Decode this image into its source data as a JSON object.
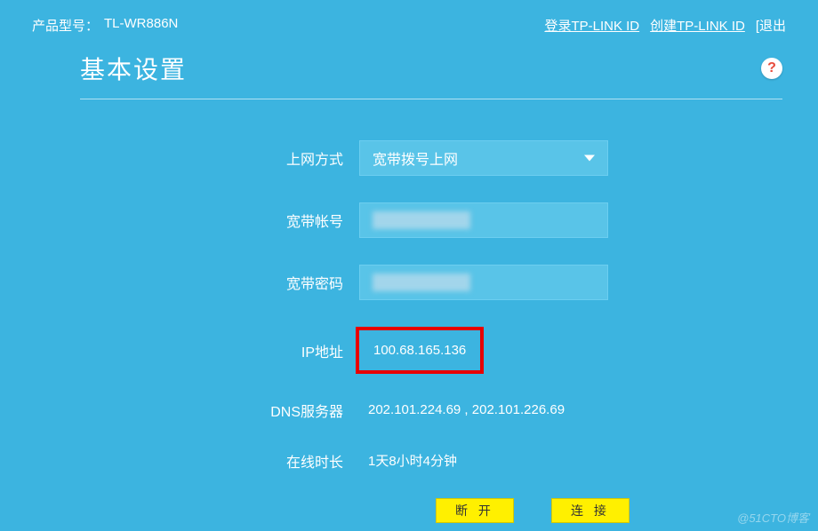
{
  "topbar": {
    "model_label": "产品型号：",
    "model_value": "TL-WR886N",
    "login_link": "登录TP-LINK ID",
    "create_link": "创建TP-LINK ID",
    "logout": "[退出"
  },
  "page": {
    "title": "基本设置",
    "help_glyph": "?"
  },
  "form": {
    "conn_type": {
      "label": "上网方式",
      "value": "宽带拨号上网"
    },
    "account": {
      "label": "宽带帐号"
    },
    "password": {
      "label": "宽带密码"
    },
    "ip": {
      "label": "IP地址",
      "value": "100.68.165.136"
    },
    "dns": {
      "label": "DNS服务器",
      "value": "202.101.224.69 , 202.101.226.69"
    },
    "uptime": {
      "label": "在线时长",
      "value": "1天8小时4分钟"
    }
  },
  "buttons": {
    "disconnect": "断 开",
    "connect": "连 接"
  },
  "watermark": "@51CTO博客"
}
